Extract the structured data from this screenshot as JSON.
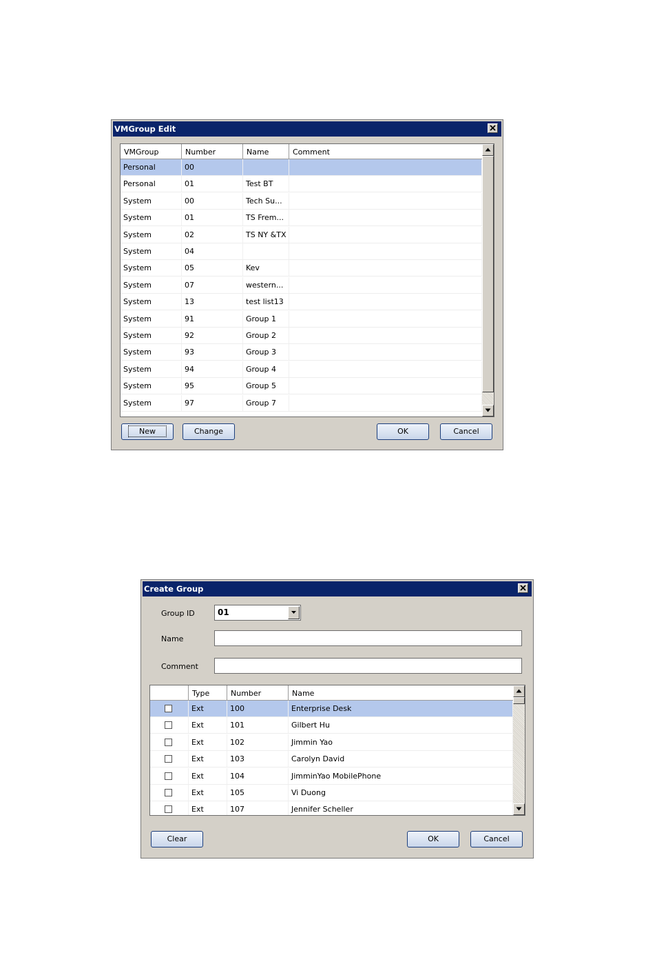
{
  "vmgroup_edit": {
    "title": "VMGroup Edit",
    "columns": [
      "VMGroup",
      "Number",
      "Name",
      "Comment"
    ],
    "rows": [
      {
        "vmgroup": "Personal",
        "number": "00",
        "name": "",
        "comment": "",
        "selected": true
      },
      {
        "vmgroup": "Personal",
        "number": "01",
        "name": "Test BT",
        "comment": ""
      },
      {
        "vmgroup": "System",
        "number": "00",
        "name": "Tech Su...",
        "comment": ""
      },
      {
        "vmgroup": "System",
        "number": "01",
        "name": "TS Frem...",
        "comment": ""
      },
      {
        "vmgroup": "System",
        "number": "02",
        "name": "TS NY &TX",
        "comment": ""
      },
      {
        "vmgroup": "System",
        "number": "04",
        "name": "",
        "comment": ""
      },
      {
        "vmgroup": "System",
        "number": "05",
        "name": "Kev",
        "comment": ""
      },
      {
        "vmgroup": "System",
        "number": "07",
        "name": "western...",
        "comment": ""
      },
      {
        "vmgroup": "System",
        "number": "13",
        "name": "test list13",
        "comment": ""
      },
      {
        "vmgroup": "System",
        "number": "91",
        "name": "Group 1",
        "comment": ""
      },
      {
        "vmgroup": "System",
        "number": "92",
        "name": "Group 2",
        "comment": ""
      },
      {
        "vmgroup": "System",
        "number": "93",
        "name": "Group 3",
        "comment": ""
      },
      {
        "vmgroup": "System",
        "number": "94",
        "name": "Group 4",
        "comment": ""
      },
      {
        "vmgroup": "System",
        "number": "95",
        "name": "Group 5",
        "comment": ""
      },
      {
        "vmgroup": "System",
        "number": "97",
        "name": "Group 7",
        "comment": ""
      }
    ],
    "buttons": {
      "new": "New",
      "change": "Change",
      "ok": "OK",
      "cancel": "Cancel"
    }
  },
  "create_group": {
    "title": "Create Group",
    "group_id_label": "Group ID",
    "group_id_value": "01",
    "name_label": "Name",
    "name_value": "",
    "comment_label": "Comment",
    "comment_value": "",
    "columns": [
      "",
      "Type",
      "Number",
      "Name"
    ],
    "rows": [
      {
        "checked": false,
        "type": "Ext",
        "number": "100",
        "name": "Enterprise Desk",
        "selected": true
      },
      {
        "checked": false,
        "type": "Ext",
        "number": "101",
        "name": "Gilbert Hu"
      },
      {
        "checked": false,
        "type": "Ext",
        "number": "102",
        "name": "Jimmin Yao"
      },
      {
        "checked": false,
        "type": "Ext",
        "number": "103",
        "name": "Carolyn David"
      },
      {
        "checked": false,
        "type": "Ext",
        "number": "104",
        "name": "JimminYao MobilePhone"
      },
      {
        "checked": false,
        "type": "Ext",
        "number": "105",
        "name": "Vi Duong"
      },
      {
        "checked": false,
        "type": "Ext",
        "number": "107",
        "name": "Jennifer Scheller"
      }
    ],
    "buttons": {
      "clear": "Clear",
      "ok": "OK",
      "cancel": "Cancel"
    }
  },
  "icons": {
    "close": "close-icon",
    "scroll_up": "scroll-up-arrow-icon",
    "scroll_down": "scroll-down-arrow-icon",
    "dropdown": "chevron-down-icon"
  }
}
